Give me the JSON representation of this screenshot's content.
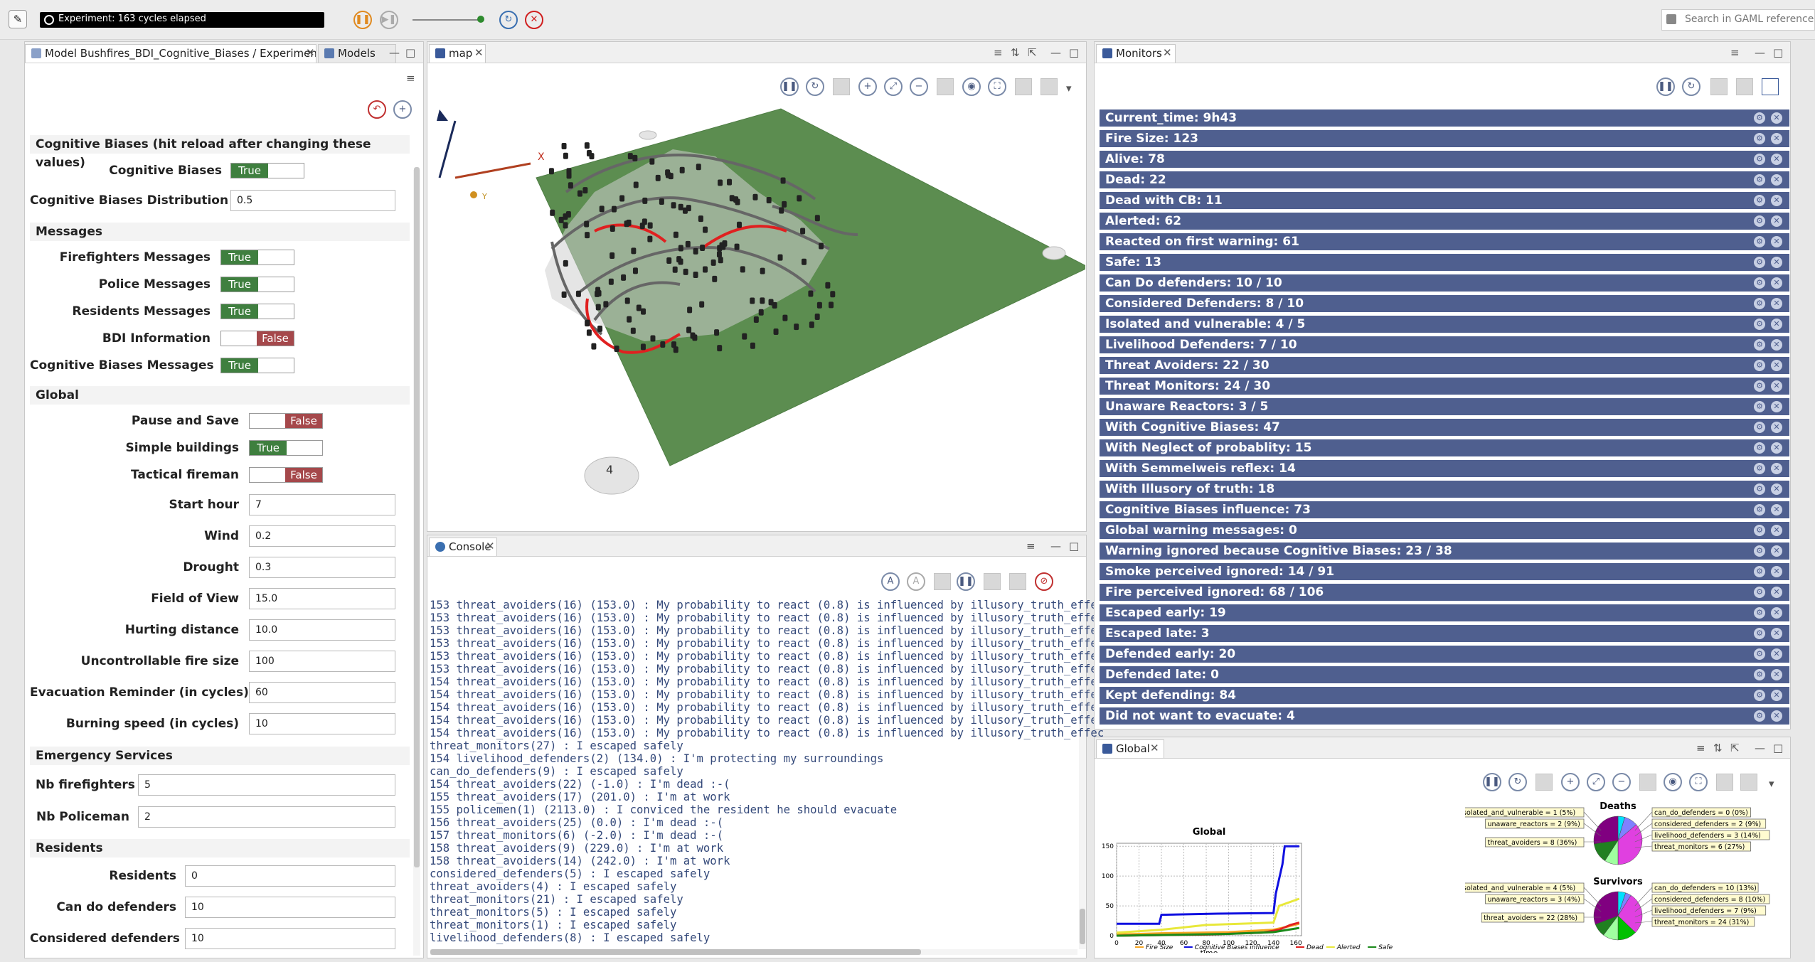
{
  "toolbar": {
    "experiment_status": "Experiment: 163 cycles elapsed",
    "search_placeholder": "Search in GAML reference (",
    "slider_level": 0.9
  },
  "left_tabs": {
    "experiment_tab": "Model Bushfires_BDI_Cognitive_Biases / Experiment ...",
    "models_tab": "Models"
  },
  "params": {
    "cb_section": "Cognitive Biases (hit reload after changing these values)",
    "cognitive_biases": {
      "label": "Cognitive Biases",
      "value": "True"
    },
    "cb_distribution": {
      "label": "Cognitive Biases Distribution",
      "value": "0.5"
    },
    "messages_section": "Messages",
    "firefighters_messages": {
      "label": "Firefighters Messages",
      "value": "True"
    },
    "police_messages": {
      "label": "Police Messages",
      "value": "True"
    },
    "residents_messages": {
      "label": "Residents Messages",
      "value": "True"
    },
    "bdi_information": {
      "label": "BDI Information",
      "value": "False"
    },
    "cb_messages": {
      "label": "Cognitive Biases Messages",
      "value": "True"
    },
    "global_section": "Global",
    "pause_and_save": {
      "label": "Pause and Save",
      "value": "False"
    },
    "simple_buildings": {
      "label": "Simple buildings",
      "value": "True"
    },
    "tactical_fireman": {
      "label": "Tactical fireman",
      "value": "False"
    },
    "start_hour": {
      "label": "Start hour",
      "value": "7"
    },
    "wind": {
      "label": "Wind",
      "value": "0.2"
    },
    "drought": {
      "label": "Drought",
      "value": "0.3"
    },
    "field_of_view": {
      "label": "Field of View",
      "value": "15.0"
    },
    "hurting_distance": {
      "label": "Hurting distance",
      "value": "10.0"
    },
    "uncontrollable_fire_size": {
      "label": "Uncontrollable fire size",
      "value": "100"
    },
    "evacuation_reminder": {
      "label": "Evacuation Reminder (in cycles)",
      "value": "60"
    },
    "burning_speed": {
      "label": "Burning speed (in cycles)",
      "value": "10"
    },
    "emergency_section": "Emergency Services",
    "nb_firefighters": {
      "label": "Nb firefighters",
      "value": "5"
    },
    "nb_policeman": {
      "label": "Nb Policeman",
      "value": "2"
    },
    "residents_section": "Residents",
    "residents": {
      "label": "Residents",
      "value": "0"
    },
    "can_do_defenders": {
      "label": "Can do defenders",
      "value": "10"
    },
    "considered_defenders": {
      "label": "Considered defenders",
      "value": "10"
    }
  },
  "map": {
    "tab": "map",
    "axis_x": "X",
    "axis_y": "Y",
    "compass": "4"
  },
  "console": {
    "tab": "Console",
    "lines": [
      "153 threat_avoiders(16) (153.0) : My probability to react (0.8) is influenced by illusory_truth_effec",
      "153 threat_avoiders(16) (153.0) : My probability to react (0.8) is influenced by illusory_truth_effec",
      "153 threat_avoiders(16) (153.0) : My probability to react (0.8) is influenced by illusory_truth_effec",
      "153 threat_avoiders(16) (153.0) : My probability to react (0.8) is influenced by illusory_truth_effec",
      "153 threat_avoiders(16) (153.0) : My probability to react (0.8) is influenced by illusory_truth_effec",
      "153 threat_avoiders(16) (153.0) : My probability to react (0.8) is influenced by illusory_truth_effec",
      "154 threat_avoiders(16) (153.0) : My probability to react (0.8) is influenced by illusory_truth_effec",
      "154 threat_avoiders(16) (153.0) : My probability to react (0.8) is influenced by illusory_truth_effec",
      "154 threat_avoiders(16) (153.0) : My probability to react (0.8) is influenced by illusory_truth_effec",
      "154 threat_avoiders(16) (153.0) : My probability to react (0.8) is influenced by illusory_truth_effec",
      "154 threat_avoiders(16) (153.0) : My probability to react (0.8) is influenced by illusory_truth_effec",
      "threat_monitors(27) : I escaped safely",
      "154 livelihood_defenders(2) (134.0) : I'm protecting my surroundings",
      "can_do_defenders(9) : I escaped safely",
      "154 threat_avoiders(22) (-1.0) : I'm dead :-(",
      "155 threat_avoiders(17) (201.0) : I'm at work",
      "155 policemen(1) (2113.0) : I conviced the resident he should evacuate",
      "156 threat_avoiders(25) (0.0) : I'm dead :-(",
      "157 threat_monitors(6) (-2.0) : I'm dead :-(",
      "158 threat_avoiders(9) (229.0) : I'm at work",
      "158 threat_avoiders(14) (242.0) : I'm at work",
      "considered_defenders(5) : I escaped safely",
      "threat_avoiders(4) : I escaped safely",
      "threat_monitors(21) : I escaped safely",
      "threat_monitors(5) : I escaped safely",
      "threat_monitors(1) : I escaped safely",
      "livelihood_defenders(8) : I escaped safely"
    ]
  },
  "monitors": {
    "tab": "Monitors",
    "items": [
      "Current_time:  9h43",
      "Fire Size:  123",
      "Alive:  78",
      "Dead:  22",
      "Dead with CB:  11",
      "Alerted:  62",
      "Reacted on first warning:  61",
      "Safe:  13",
      "Can Do defenders:  10 / 10",
      "Considered Defenders:  8 / 10",
      "Isolated and vulnerable:  4 / 5",
      "Livelihood Defenders:  7 / 10",
      "Threat Avoiders:  22 / 30",
      "Threat Monitors:  24 / 30",
      "Unaware Reactors:  3 / 5",
      "With Cognitive Biases:  47",
      "With Neglect of probablity:  15",
      "With Semmelweis reflex:  14",
      "With Illusory of truth:  18",
      "Cognitive Biases influence:  73",
      "Global warning messages:  0",
      "Warning ignored because Cognitive Biases:  23 / 38",
      "Smoke perceived ignored:  14 / 91",
      "Fire perceived ignored:  68 / 106",
      "Escaped early:  19",
      "Escaped late:  3",
      "Defended early:  20",
      "Defended late:  0",
      "Kept defending:  84",
      "Did not want to evacuate:  4"
    ]
  },
  "global_view": {
    "tab": "Global"
  },
  "chart_data": [
    {
      "type": "line",
      "title": "Global",
      "xlabel": "time",
      "ylabel": "",
      "xlim": [
        0,
        165
      ],
      "ylim": [
        0,
        155
      ],
      "xticks": [
        "0",
        "20",
        "40",
        "60",
        "80",
        "100",
        "120",
        "140",
        "160"
      ],
      "yticks": [
        "0",
        "50",
        "100",
        "150"
      ],
      "grid": true,
      "legend": "bottom",
      "series": [
        {
          "name": "Fire Size",
          "color": "#f5a623",
          "x": [
            0,
            40,
            100,
            140,
            150,
            163
          ],
          "y": [
            2,
            4,
            6,
            10,
            14,
            20
          ]
        },
        {
          "name": "Cognitive Biases influence",
          "color": "#1010e0",
          "x": [
            0,
            38,
            40,
            90,
            140,
            142,
            148,
            150,
            163
          ],
          "y": [
            20,
            20,
            35,
            37,
            38,
            70,
            120,
            150,
            150
          ]
        },
        {
          "name": "Dead",
          "color": "#e02020",
          "x": [
            0,
            80,
            130,
            145,
            155,
            163
          ],
          "y": [
            0,
            2,
            5,
            10,
            18,
            22
          ]
        },
        {
          "name": "Alerted",
          "color": "#e8e83a",
          "x": [
            0,
            40,
            80,
            140,
            145,
            163
          ],
          "y": [
            5,
            10,
            18,
            22,
            50,
            62
          ]
        },
        {
          "name": "Safe",
          "color": "#1a8a1a",
          "x": [
            0,
            100,
            140,
            163
          ],
          "y": [
            0,
            3,
            6,
            13
          ]
        }
      ]
    },
    {
      "type": "pie",
      "title": "Deaths",
      "labels": [
        "isolated_and_vulnerable = 1 (5%)",
        "unaware_reactors = 2 (9%)",
        "threat_avoiders = 8 (36%)",
        "can_do_defenders = 0 (0%)",
        "considered_defenders = 2 (9%)",
        "livelihood_defenders = 3 (14%)",
        "threat_monitors = 6 (27%)"
      ],
      "values": [
        1,
        2,
        8,
        0,
        2,
        3,
        6
      ],
      "colors": [
        "#00e0ff",
        "#8080ff",
        "#e040e0",
        "#00c000",
        "#a0ffa0",
        "#208020",
        "#800080"
      ]
    },
    {
      "type": "pie",
      "title": "Survivors",
      "labels": [
        "isolated_and_vulnerable = 4 (5%)",
        "unaware_reactors = 3 (4%)",
        "threat_avoiders = 22 (28%)",
        "can_do_defenders = 10 (13%)",
        "considered_defenders = 8 (10%)",
        "livelihood_defenders = 7 (9%)",
        "threat_monitors = 24 (31%)"
      ],
      "values": [
        4,
        3,
        22,
        10,
        8,
        7,
        24
      ],
      "colors": [
        "#00e0ff",
        "#8080ff",
        "#e040e0",
        "#00c000",
        "#a0ffa0",
        "#208020",
        "#800080"
      ]
    }
  ]
}
